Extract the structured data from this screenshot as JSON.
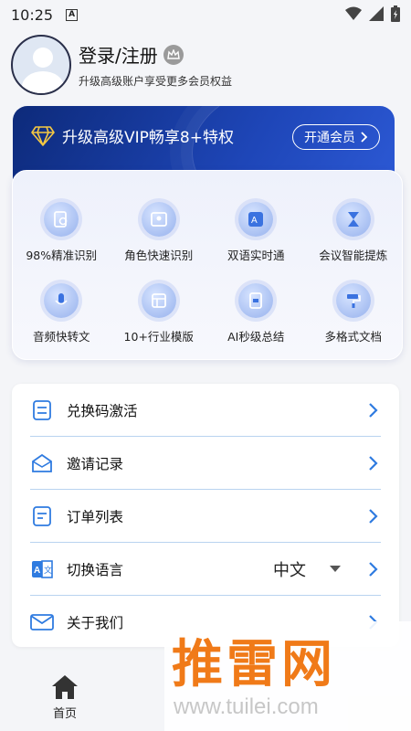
{
  "status_bar": {
    "time": "10:25",
    "a_badge": "A"
  },
  "profile": {
    "title": "登录/注册",
    "subtitle": "升级高级账户享受更多会员权益"
  },
  "vip": {
    "title": "升级高级VIP畅享8+特权",
    "button": "开通会员"
  },
  "features": [
    {
      "label": "98%精准识别",
      "icon": "document-scan-icon"
    },
    {
      "label": "角色快速识别",
      "icon": "people-id-icon"
    },
    {
      "label": "双语实时通",
      "icon": "translate-icon"
    },
    {
      "label": "会议智能提炼",
      "icon": "hourglass-icon"
    },
    {
      "label": "音频快转文",
      "icon": "microphone-icon"
    },
    {
      "label": "10+行业模版",
      "icon": "template-icon"
    },
    {
      "label": "AI秒级总结",
      "icon": "ai-summary-icon"
    },
    {
      "label": "多格式文档",
      "icon": "paint-roller-icon"
    }
  ],
  "menu": [
    {
      "label": "兑换码激活",
      "icon": "exchange-code-icon"
    },
    {
      "label": "邀请记录",
      "icon": "envelope-open-icon"
    },
    {
      "label": "订单列表",
      "icon": "order-list-icon"
    },
    {
      "label": "切换语言",
      "icon": "language-icon",
      "value": "中文"
    },
    {
      "label": "关于我们",
      "icon": "mail-icon"
    }
  ],
  "bottom_nav": {
    "home": "首页"
  },
  "watermark": {
    "main": "推雷网",
    "url": "www.tuilei.com"
  },
  "colors": {
    "accent": "#2f7be0",
    "vip_bg": "#1e46b8",
    "watermark": "#f07a18"
  }
}
